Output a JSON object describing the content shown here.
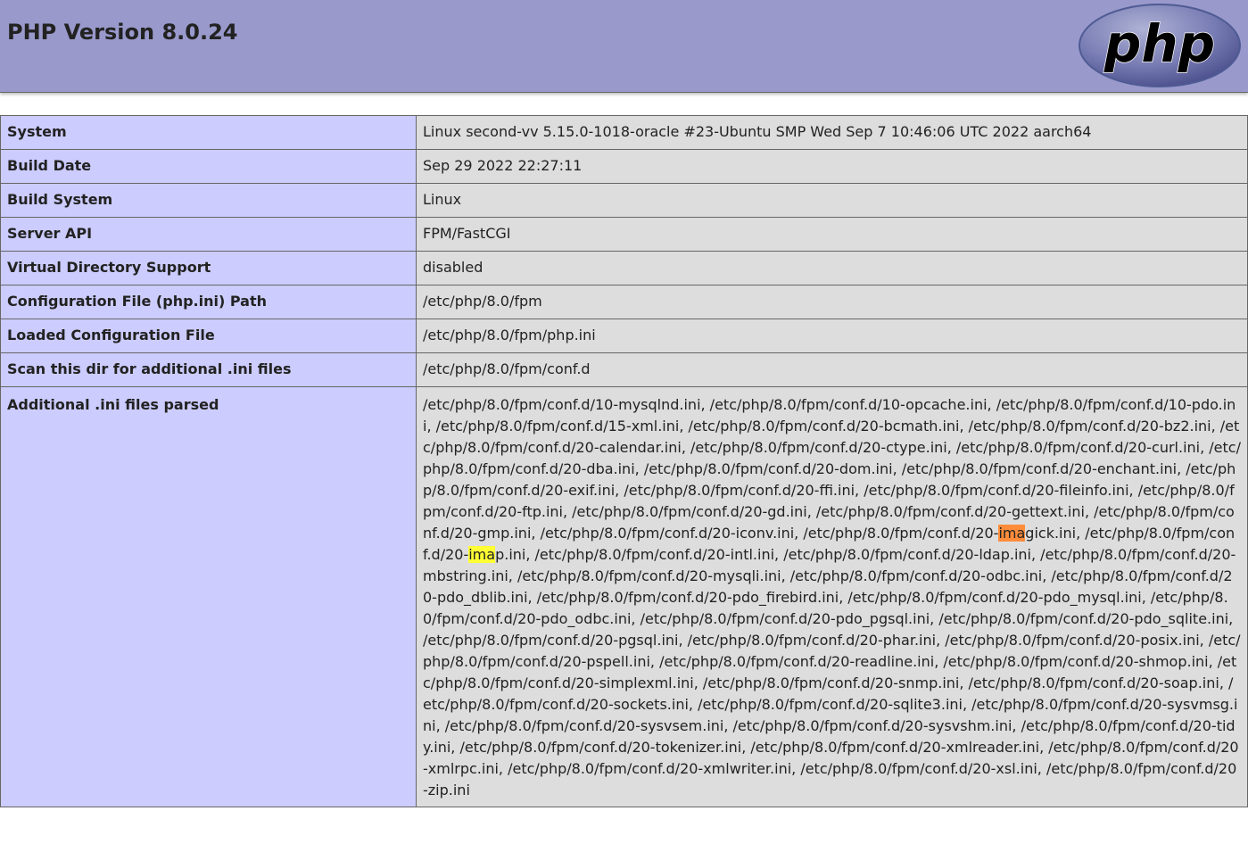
{
  "header": {
    "title": "PHP Version 8.0.24",
    "logo_text": "php"
  },
  "rows": [
    {
      "key": "System",
      "value": "Linux second-vv 5.15.0-1018-oracle #23-Ubuntu SMP Wed Sep 7 10:46:06 UTC 2022 aarch64"
    },
    {
      "key": "Build Date",
      "value": "Sep 29 2022 22:27:11"
    },
    {
      "key": "Build System",
      "value": "Linux"
    },
    {
      "key": "Server API",
      "value": "FPM/FastCGI"
    },
    {
      "key": "Virtual Directory Support",
      "value": "disabled"
    },
    {
      "key": "Configuration File (php.ini) Path",
      "value": "/etc/php/8.0/fpm"
    },
    {
      "key": "Loaded Configuration File",
      "value": "/etc/php/8.0/fpm/php.ini"
    },
    {
      "key": "Scan this dir for additional .ini files",
      "value": "/etc/php/8.0/fpm/conf.d"
    }
  ],
  "additional": {
    "key": "Additional .ini files parsed",
    "part1": "/etc/php/8.0/fpm/conf.d/10-mysqlnd.ini, /etc/php/8.0/fpm/conf.d/10-opcache.ini, /etc/php/8.0/fpm/conf.d/10-pdo.ini, /etc/php/8.0/fpm/conf.d/15-xml.ini, /etc/php/8.0/fpm/conf.d/20-bcmath.ini, /etc/php/8.0/fpm/conf.d/20-bz2.ini, /etc/php/8.0/fpm/conf.d/20-calendar.ini, /etc/php/8.0/fpm/conf.d/20-ctype.ini, /etc/php/8.0/fpm/conf.d/20-curl.ini, /etc/php/8.0/fpm/conf.d/20-dba.ini, /etc/php/8.0/fpm/conf.d/20-dom.ini, /etc/php/8.0/fpm/conf.d/20-enchant.ini, /etc/php/8.0/fpm/conf.d/20-exif.ini, /etc/php/8.0/fpm/conf.d/20-ffi.ini, /etc/php/8.0/fpm/conf.d/20-fileinfo.ini, /etc/php/8.0/fpm/conf.d/20-ftp.ini, /etc/php/8.0/fpm/conf.d/20-gd.ini, /etc/php/8.0/fpm/conf.d/20-gettext.ini, /etc/php/8.0/fpm/conf.d/20-gmp.ini, /etc/php/8.0/fpm/conf.d/20-iconv.ini, /etc/php/8.0/fpm/conf.d/20-",
    "highlight1": "ima",
    "part2": "gick.ini, /etc/php/8.0/fpm/conf.d/20-",
    "highlight2": "ima",
    "part3": "p.ini, /etc/php/8.0/fpm/conf.d/20-intl.ini, /etc/php/8.0/fpm/conf.d/20-ldap.ini, /etc/php/8.0/fpm/conf.d/20-mbstring.ini, /etc/php/8.0/fpm/conf.d/20-mysqli.ini, /etc/php/8.0/fpm/conf.d/20-odbc.ini, /etc/php/8.0/fpm/conf.d/20-pdo_dblib.ini, /etc/php/8.0/fpm/conf.d/20-pdo_firebird.ini, /etc/php/8.0/fpm/conf.d/20-pdo_mysql.ini, /etc/php/8.0/fpm/conf.d/20-pdo_odbc.ini, /etc/php/8.0/fpm/conf.d/20-pdo_pgsql.ini, /etc/php/8.0/fpm/conf.d/20-pdo_sqlite.ini, /etc/php/8.0/fpm/conf.d/20-pgsql.ini, /etc/php/8.0/fpm/conf.d/20-phar.ini, /etc/php/8.0/fpm/conf.d/20-posix.ini, /etc/php/8.0/fpm/conf.d/20-pspell.ini, /etc/php/8.0/fpm/conf.d/20-readline.ini, /etc/php/8.0/fpm/conf.d/20-shmop.ini, /etc/php/8.0/fpm/conf.d/20-simplexml.ini, /etc/php/8.0/fpm/conf.d/20-snmp.ini, /etc/php/8.0/fpm/conf.d/20-soap.ini, /etc/php/8.0/fpm/conf.d/20-sockets.ini, /etc/php/8.0/fpm/conf.d/20-sqlite3.ini, /etc/php/8.0/fpm/conf.d/20-sysvmsg.ini, /etc/php/8.0/fpm/conf.d/20-sysvsem.ini, /etc/php/8.0/fpm/conf.d/20-sysvshm.ini, /etc/php/8.0/fpm/conf.d/20-tidy.ini, /etc/php/8.0/fpm/conf.d/20-tokenizer.ini, /etc/php/8.0/fpm/conf.d/20-xmlreader.ini, /etc/php/8.0/fpm/conf.d/20-xmlrpc.ini, /etc/php/8.0/fpm/conf.d/20-xmlwriter.ini, /etc/php/8.0/fpm/conf.d/20-xsl.ini, /etc/php/8.0/fpm/conf.d/20-zip.ini"
  },
  "colors": {
    "header_bg": "#9999cc",
    "key_cell_bg": "#ccccff",
    "value_cell_bg": "#dddddd",
    "current_match_highlight": "#ff8c3a",
    "match_highlight": "#ffff33"
  }
}
